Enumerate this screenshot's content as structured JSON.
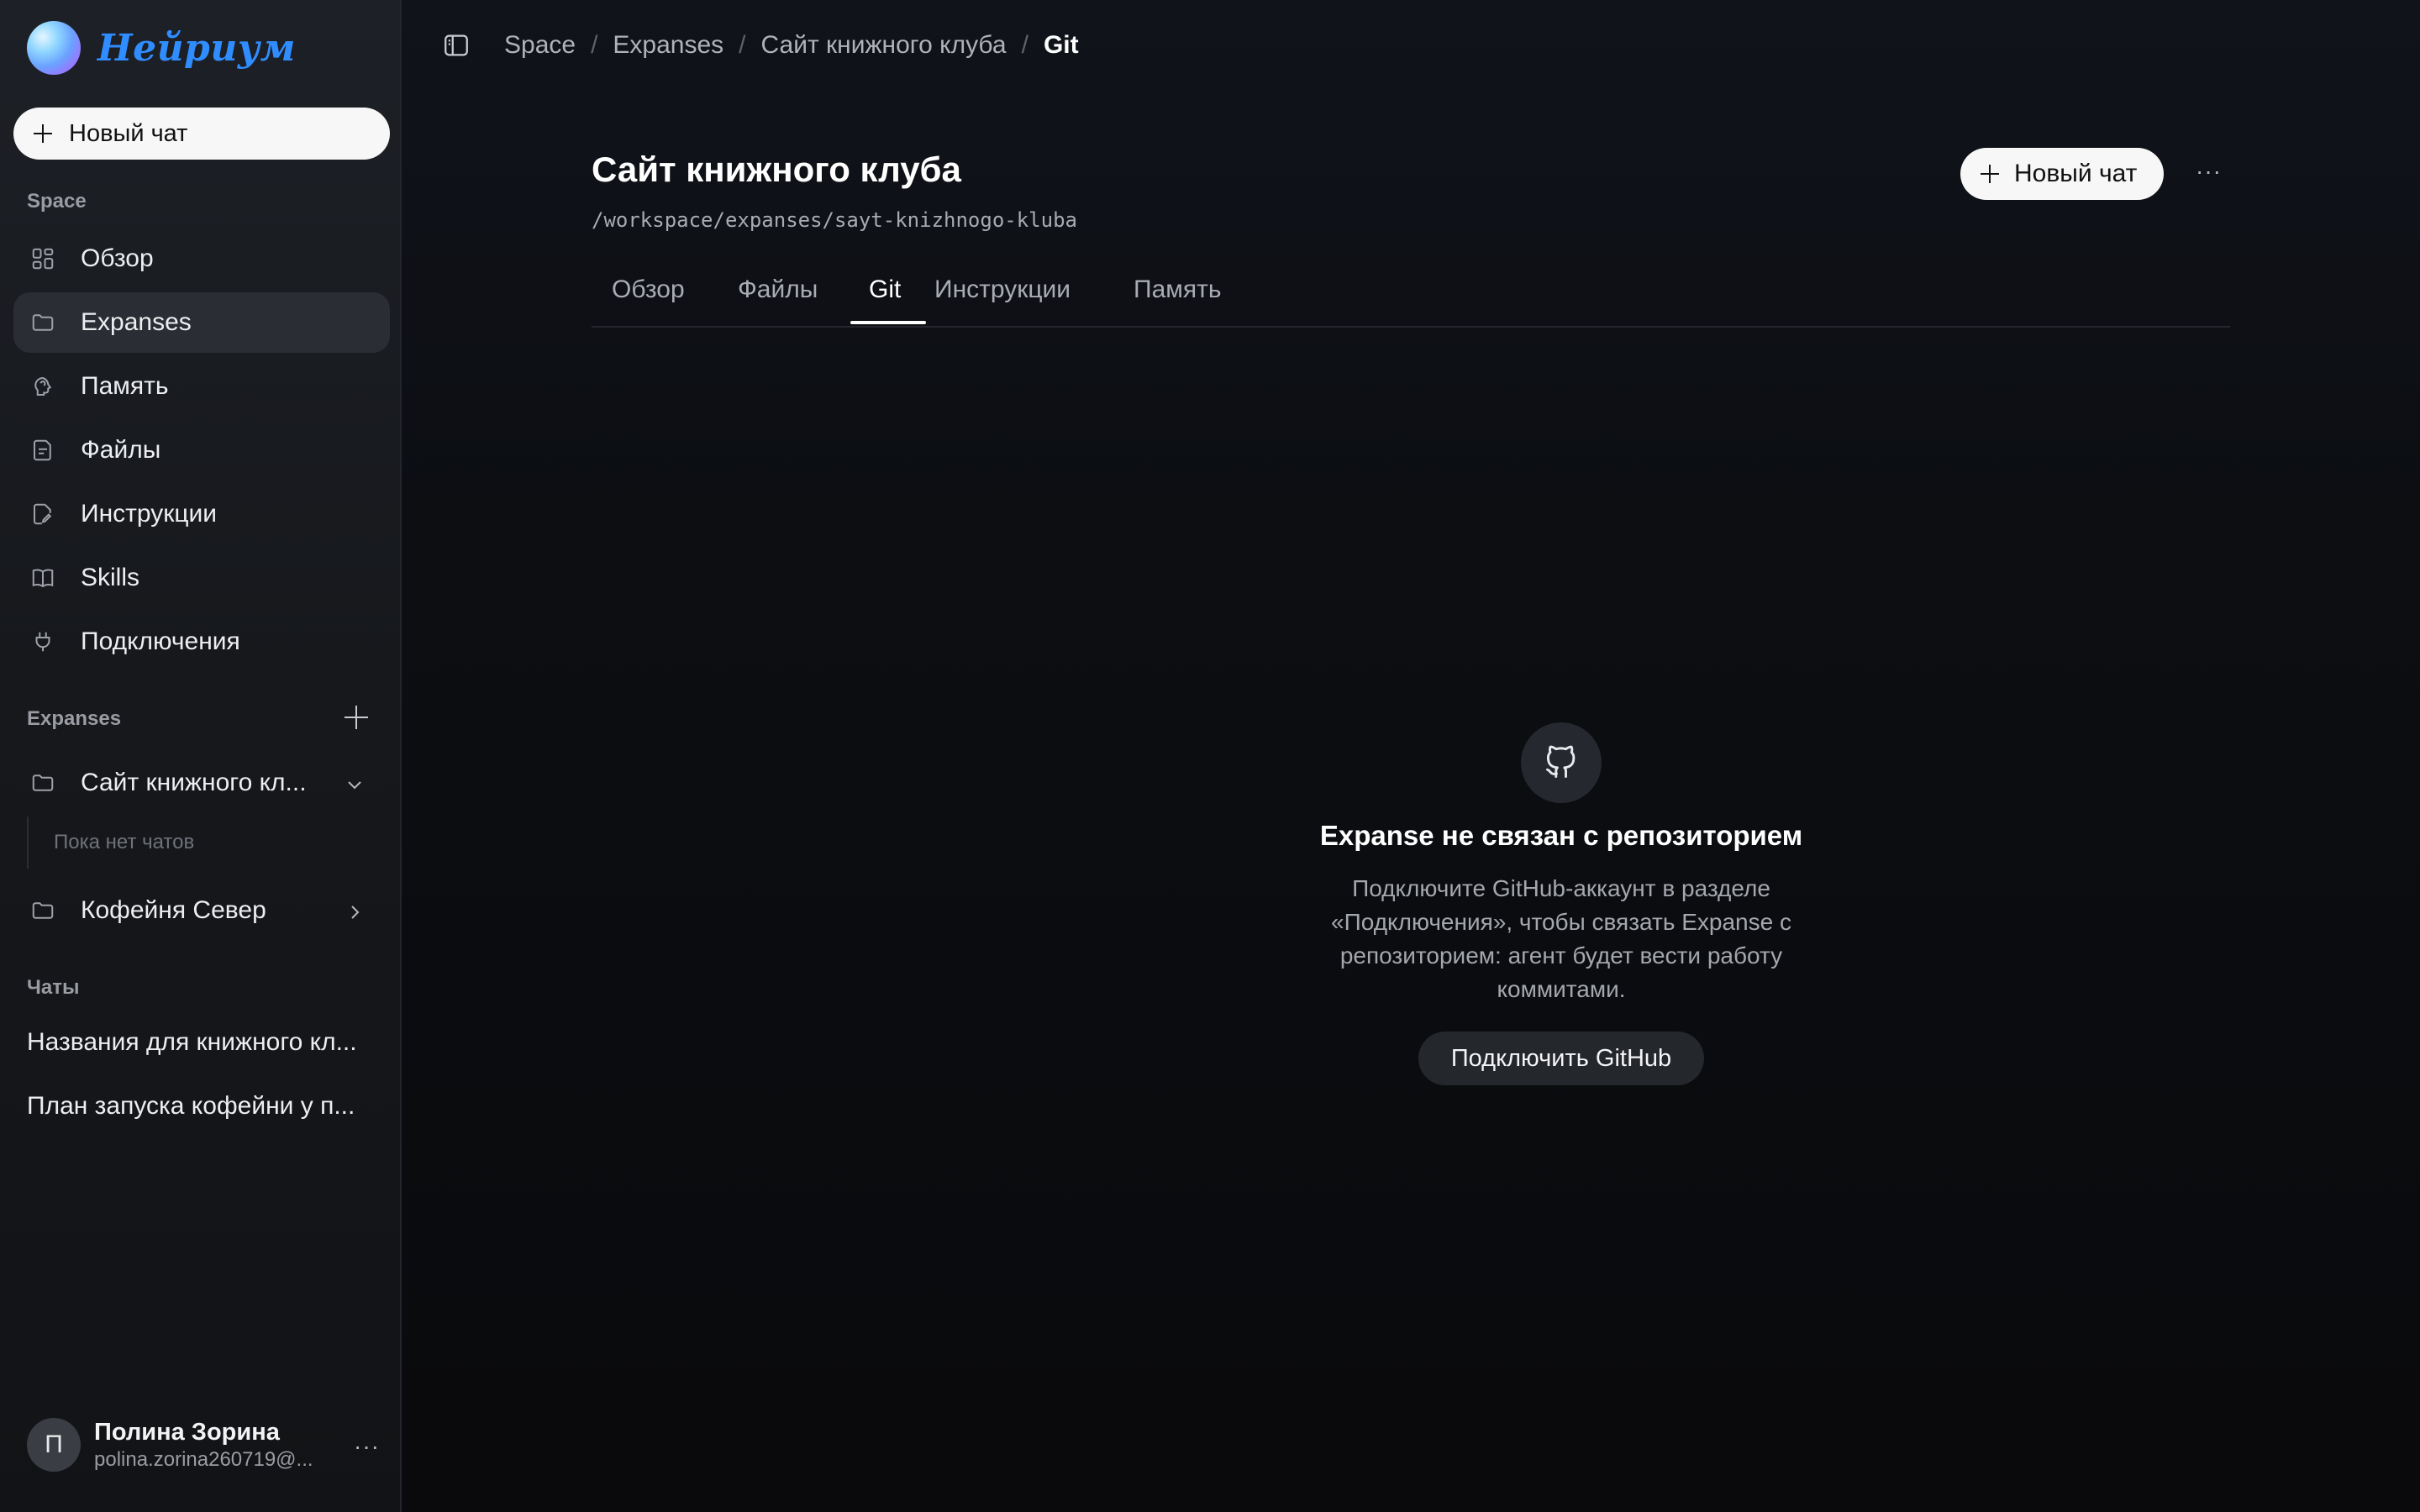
{
  "brand": {
    "name": "Нейриум"
  },
  "sidebar": {
    "new_chat_label": "Новый чат",
    "space_label": "Space",
    "nav": [
      {
        "label": "Обзор",
        "icon": "dashboard-icon"
      },
      {
        "label": "Expanses",
        "icon": "folder-icon",
        "active": true
      },
      {
        "label": "Память",
        "icon": "brain-icon"
      },
      {
        "label": "Файлы",
        "icon": "file-icon"
      },
      {
        "label": "Инструкции",
        "icon": "edit-file-icon"
      },
      {
        "label": "Skills",
        "icon": "book-icon"
      },
      {
        "label": "Подключения",
        "icon": "plug-icon"
      }
    ],
    "expanses_label": "Expanses",
    "expanses": [
      {
        "label": "Сайт книжного кл...",
        "expanded": true,
        "empty_text": "Пока нет чатов"
      },
      {
        "label": "Кофейня Север",
        "expanded": false
      }
    ],
    "chats_label": "Чаты",
    "chats": [
      "Названия для книжного кл...",
      "План запуска кофейни у п..."
    ],
    "user": {
      "initial": "П",
      "name": "Полина Зорина",
      "email": "polina.zorina260719@..."
    }
  },
  "breadcrumb": [
    "Space",
    "Expanses",
    "Сайт книжного клуба",
    "Git"
  ],
  "page": {
    "title": "Сайт книжного клуба",
    "path": "/workspace/expanses/sayt-knizhnogo-kluba",
    "new_chat_label": "Новый чат",
    "more_label": "···"
  },
  "tabs": [
    "Обзор",
    "Файлы",
    "Git",
    "Инструкции",
    "Память"
  ],
  "active_tab": "Git",
  "empty_state": {
    "icon": "github-icon",
    "title": "Expanse не связан с репозиторием",
    "description": "Подключите GitHub-аккаунт в разделе «Подключения», чтобы связать Expanse с репозиторием: агент будет вести работу коммитами.",
    "button_label": "Подключить GitHub"
  },
  "colors": {
    "accent": "#2f8dff",
    "background": "#0b0c0e",
    "sidebar": "#1a1c21"
  }
}
